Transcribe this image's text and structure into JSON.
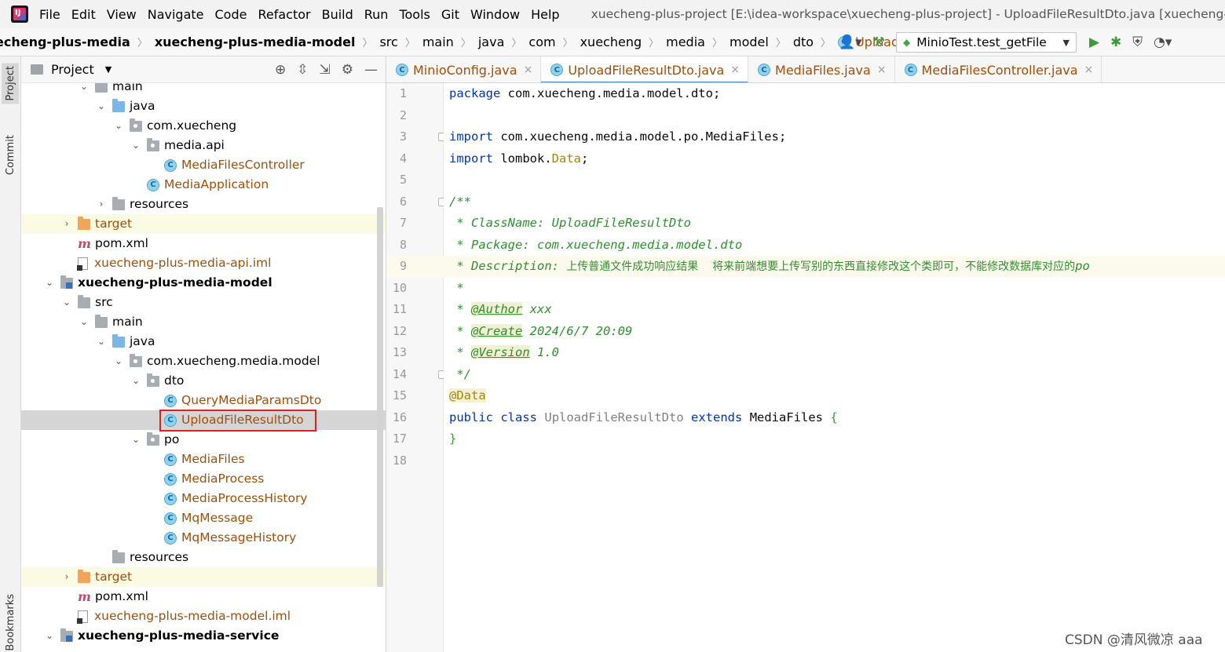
{
  "menu": {
    "items": [
      "File",
      "Edit",
      "View",
      "Navigate",
      "Code",
      "Refactor",
      "Build",
      "Run",
      "Tools",
      "Git",
      "Window",
      "Help"
    ],
    "window_title": "xuecheng-plus-project [E:\\idea-workspace\\xuecheng-plus-project] - UploadFileResultDto.java [xuecheng-plus-m"
  },
  "breadcrumb": {
    "items": [
      "echeng-plus-media",
      "xuecheng-plus-media-model",
      "src",
      "main",
      "java",
      "com",
      "xuecheng",
      "media",
      "model",
      "dto"
    ],
    "current_class": "UploadFileResultDto"
  },
  "run_config": {
    "label": "MinioTest.test_getFile"
  },
  "left_strip": {
    "project": "Project",
    "commit": "Commit",
    "bookmarks": "Bookmarks"
  },
  "project_panel": {
    "title": "Project",
    "tree": [
      {
        "label": "main",
        "indent": 4,
        "toggle": "v",
        "icon": "folder"
      },
      {
        "label": "java",
        "indent": 5,
        "toggle": "v",
        "icon": "folder-blue"
      },
      {
        "label": "com.xuecheng",
        "indent": 6,
        "toggle": "v",
        "icon": "folder-pkg"
      },
      {
        "label": "media.api",
        "indent": 7,
        "toggle": "v",
        "icon": "folder-pkg"
      },
      {
        "label": "MediaFilesController",
        "indent": 8,
        "toggle": "",
        "icon": "class"
      },
      {
        "label": "MediaApplication",
        "indent": 7,
        "toggle": "",
        "icon": "class-run"
      },
      {
        "label": "resources",
        "indent": 5,
        "toggle": ">",
        "icon": "folder"
      },
      {
        "label": "target",
        "indent": 3,
        "toggle": ">",
        "icon": "folder-orange",
        "excluded": true
      },
      {
        "label": "pom.xml",
        "indent": 3,
        "toggle": "",
        "icon": "maven"
      },
      {
        "label": "xuecheng-plus-media-api.iml",
        "indent": 3,
        "toggle": "",
        "icon": "iml"
      },
      {
        "label": "xuecheng-plus-media-model",
        "indent": 2,
        "toggle": "v",
        "icon": "folder-module",
        "bold": true
      },
      {
        "label": "src",
        "indent": 3,
        "toggle": "v",
        "icon": "folder"
      },
      {
        "label": "main",
        "indent": 4,
        "toggle": "v",
        "icon": "folder"
      },
      {
        "label": "java",
        "indent": 5,
        "toggle": "v",
        "icon": "folder-blue"
      },
      {
        "label": "com.xuecheng.media.model",
        "indent": 6,
        "toggle": "v",
        "icon": "folder-pkg"
      },
      {
        "label": "dto",
        "indent": 7,
        "toggle": "v",
        "icon": "folder-pkg"
      },
      {
        "label": "QueryMediaParamsDto",
        "indent": 8,
        "toggle": "",
        "icon": "class"
      },
      {
        "label": "UploadFileResultDto",
        "indent": 8,
        "toggle": "",
        "icon": "class",
        "selected": true
      },
      {
        "label": "po",
        "indent": 7,
        "toggle": "v",
        "icon": "folder-pkg"
      },
      {
        "label": "MediaFiles",
        "indent": 8,
        "toggle": "",
        "icon": "class"
      },
      {
        "label": "MediaProcess",
        "indent": 8,
        "toggle": "",
        "icon": "class"
      },
      {
        "label": "MediaProcessHistory",
        "indent": 8,
        "toggle": "",
        "icon": "class"
      },
      {
        "label": "MqMessage",
        "indent": 8,
        "toggle": "",
        "icon": "class"
      },
      {
        "label": "MqMessageHistory",
        "indent": 8,
        "toggle": "",
        "icon": "class"
      },
      {
        "label": "resources",
        "indent": 5,
        "toggle": "",
        "icon": "folder"
      },
      {
        "label": "target",
        "indent": 3,
        "toggle": ">",
        "icon": "folder-orange",
        "excluded": true
      },
      {
        "label": "pom.xml",
        "indent": 3,
        "toggle": "",
        "icon": "maven"
      },
      {
        "label": "xuecheng-plus-media-model.iml",
        "indent": 3,
        "toggle": "",
        "icon": "iml"
      },
      {
        "label": "xuecheng-plus-media-service",
        "indent": 2,
        "toggle": "v",
        "icon": "folder-module",
        "bold": true
      }
    ]
  },
  "editor": {
    "tabs": [
      {
        "label": "MinioConfig.java",
        "active": false
      },
      {
        "label": "UploadFileResultDto.java",
        "active": true
      },
      {
        "label": "MediaFiles.java",
        "active": false
      },
      {
        "label": "MediaFilesController.java",
        "active": false
      }
    ],
    "line_numbers": [
      "1",
      "2",
      "3",
      "4",
      "5",
      "6",
      "7",
      "8",
      "9",
      "10",
      "11",
      "12",
      "13",
      "14",
      "15",
      "16",
      "17",
      "18"
    ],
    "highlighted_line": 9,
    "code": {
      "l1_kw": "package",
      "l1_rest": " com.xuecheng.media.model.dto;",
      "l3_kw": "import",
      "l3_rest": " com.xuecheng.media.model.po.MediaFiles;",
      "l4_kw": "import",
      "l4_rest_a": " lombok.",
      "l4_data": "Data",
      "l4_semi": ";",
      "l6": "/**",
      "l7": " * ClassName: UploadFileResultDto",
      "l8": " * Package: com.xuecheng.media.model.dto",
      "l9_a": " * Description: ",
      "l9_cjk": "上传普通文件成功响应结果    将来前端想要上传写别的东西直接修改这个类即可，不能修改数据库对应的",
      "l9_po": "po",
      "l10": " *",
      "l11_star": " * ",
      "l11_tag": "@Author",
      "l11_val": " xxx",
      "l12_star": " * ",
      "l12_tag": "@Create",
      "l12_val": " 2024/6/7 20:09",
      "l13_star": " * ",
      "l13_tag": "@Version",
      "l13_val": " 1.0",
      "l14": " */",
      "l15": "@Data",
      "l16_kw1": "public",
      "l16_kw2": "class",
      "l16_name": "UploadFileResultDto",
      "l16_kw3": "extends",
      "l16_parent": "MediaFiles",
      "l16_brace": "{",
      "l17": "}"
    }
  },
  "watermark": "CSDN @清风微凉 aaa"
}
